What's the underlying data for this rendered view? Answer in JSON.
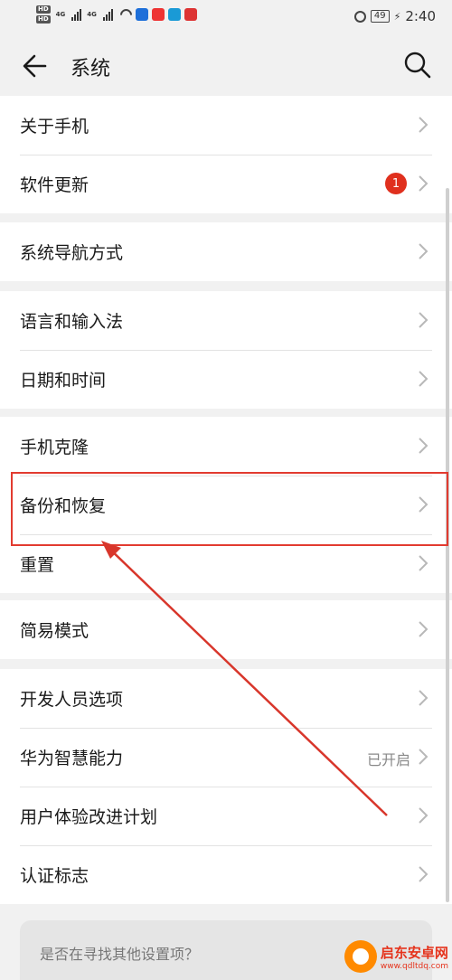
{
  "status_bar": {
    "network_type": "4G",
    "battery": "49",
    "time": "2:40",
    "icons": [
      "hd-icon",
      "signal-icon",
      "wifi-icon",
      "app-icon",
      "alarm-icon",
      "battery-icon"
    ]
  },
  "header": {
    "title": "系统",
    "back_icon": "back-arrow-icon",
    "search_icon": "search-icon"
  },
  "groups": [
    {
      "items": [
        {
          "label": "关于手机"
        },
        {
          "label": "软件更新",
          "badge": "1"
        }
      ]
    },
    {
      "items": [
        {
          "label": "系统导航方式"
        }
      ]
    },
    {
      "items": [
        {
          "label": "语言和输入法"
        },
        {
          "label": "日期和时间"
        }
      ]
    },
    {
      "items": [
        {
          "label": "手机克隆"
        },
        {
          "label": "备份和恢复"
        },
        {
          "label": "重置"
        }
      ]
    },
    {
      "items": [
        {
          "label": "简易模式"
        }
      ]
    },
    {
      "items": [
        {
          "label": "开发人员选项"
        },
        {
          "label": "华为智慧能力",
          "value": "已开启"
        },
        {
          "label": "用户体验改进计划"
        },
        {
          "label": "认证标志"
        }
      ]
    }
  ],
  "suggestion": {
    "text": "是否在寻找其他设置项？"
  },
  "watermark": {
    "name": "启东安卓网",
    "url": "www.qdltdq.com"
  },
  "colors": {
    "background": "#f1f1f1",
    "card": "#ffffff",
    "badge": "#e0301e",
    "highlight": "#e23b30"
  }
}
